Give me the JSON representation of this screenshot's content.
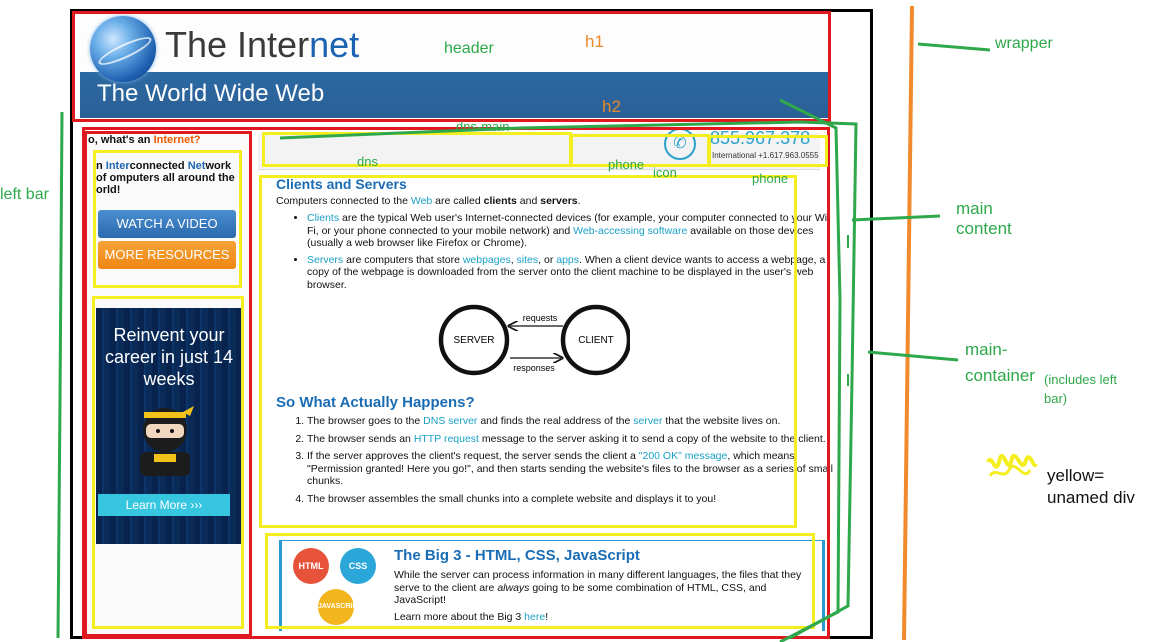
{
  "header": {
    "title_prefix": "The Inter",
    "title_highlight": "net",
    "subtitle": "The World Wide Web"
  },
  "left_bar": {
    "question_prefix": "o, what's an ",
    "question_highlight": "Internet?",
    "definition_pre": "n ",
    "definition_b1": "Inter",
    "definition_mid": "connected ",
    "definition_b2": "Net",
    "definition_post": "work of omputers all around the orld!",
    "watch_video_label": "WATCH A VIDEO",
    "more_resources_label": "MORE RESOURCES",
    "ad_text": "Reinvent your career in just 14 weeks",
    "ad_button_label": "Learn More ›››"
  },
  "phone": {
    "number": "855.967.378",
    "international": "International +1.617.963.0555"
  },
  "clients_servers": {
    "title": "Clients and Servers",
    "intro_pre": "Computers connected to the ",
    "intro_link": "Web",
    "intro_mid": " are called ",
    "intro_b1": "clients",
    "intro_and": " and ",
    "intro_b2": "servers",
    "intro_end": ".",
    "item1_link": "Clients",
    "item1_text": " are the typical Web user's Internet-connected devices (for example, your computer connected to your Wi-Fi, or your phone connected to your mobile network) and ",
    "item1_link2": "Web-accessing software",
    "item1_end": " available on those devices (usually a web browser like Firefox or Chrome).",
    "item2_link": "Servers",
    "item2_text": " are computers that store ",
    "item2_l2": "webpages",
    "item2_c": ", ",
    "item2_l3": "sites",
    "item2_or": ", or ",
    "item2_l4": "apps",
    "item2_end": ". When a client device wants to access a webpage, a copy of the webpage is downloaded from the server onto the client machine to be displayed in the user's web browser."
  },
  "diagram": {
    "server": "SERVER",
    "client": "CLIENT",
    "requests": "requests",
    "responses": "responses"
  },
  "what_happens": {
    "title": "So What Actually Happens?",
    "s1_pre": "The browser goes to the ",
    "s1_link": "DNS server",
    "s1_mid": " and finds the real address of the ",
    "s1_link2": "server",
    "s1_end": " that the website lives on.",
    "s2_pre": "The browser sends an ",
    "s2_link": "HTTP request",
    "s2_end": " message to the server asking it to send a copy of the website to the client.",
    "s3_pre": "If the server approves the client's request, the server sends the client a ",
    "s3_link": "\"200 OK\" message",
    "s3_end": ", which means \"Permission granted! Here you go!\", and then starts sending the website's files to the browser as a series of small chunks.",
    "s4": "The browser assembles the small chunks into a complete website and displays it to you!"
  },
  "big3": {
    "title": "The Big 3 - HTML, CSS, JavaScript",
    "text_pre": "While the server can process information in many different languages, the files that they serve to the client are ",
    "text_em": "always",
    "text_end": " going to be some combination of HTML, CSS, and JavaScript!",
    "more_pre": "Learn more about the Big 3 ",
    "more_link": "here",
    "more_end": "!",
    "badge_html": "HTML",
    "badge_css": "CSS",
    "badge_js": "JAVASCRIPT"
  },
  "annotations": {
    "header": "header",
    "h1": "h1",
    "wrapper": "wrapper",
    "h2": "h2",
    "dns_main": "dns-main",
    "dns": "dns",
    "phone": "phone",
    "icon": "icon",
    "phone2": "phone",
    "left_bar": "left bar",
    "main_content_1": "main",
    "main_content_2": "content",
    "main_container": "main-",
    "main_container_2": "container",
    "includes": "(includes left",
    "includes_2": "bar)",
    "legend_1": "yellow=",
    "legend_2": "unamed div"
  },
  "colors": {
    "annotation_red": "#e0191f",
    "annotation_yellow": "#f5ee1e",
    "annotation_green": "#2ea84a",
    "annotation_orange": "#e8892b",
    "link": "#1aa0c6"
  }
}
